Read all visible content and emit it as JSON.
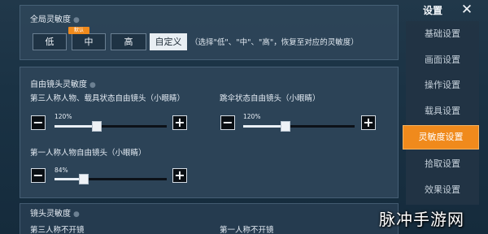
{
  "header": {
    "title": "设置",
    "close_glyph": "✕"
  },
  "global_sensitivity": {
    "title": "全局灵敏度",
    "recommended_badge": "默认",
    "options": [
      {
        "label": "低"
      },
      {
        "label": "中"
      },
      {
        "label": "高"
      },
      {
        "label": "自定义"
      }
    ],
    "selected": "自定义",
    "hint": "（选择\"低\"、\"中\"、\"高\"，恢复至对应的灵敏度）"
  },
  "free_camera": {
    "title": "自由镜头灵敏度",
    "sliders": [
      {
        "label": "第三人称人物、载具状态自由镜头（小眼睛）",
        "value_text": "120%",
        "fraction": 0.38
      },
      {
        "label": "跳伞状态自由镜头（小眼睛）",
        "value_text": "120%",
        "fraction": 0.38
      },
      {
        "label": "第一人称人物自由镜头（小眼睛）",
        "value_text": "84%",
        "fraction": 0.26
      }
    ]
  },
  "lens_sensitivity": {
    "title": "镜头灵敏度",
    "labels": [
      "第三人称不开镜",
      "第一人称不开镜"
    ]
  },
  "sidebar": {
    "items": [
      {
        "label": "基础设置"
      },
      {
        "label": "画面设置"
      },
      {
        "label": "操作设置"
      },
      {
        "label": "载具设置"
      },
      {
        "label": "灵敏度设置"
      },
      {
        "label": "拾取设置"
      },
      {
        "label": "效果设置"
      }
    ],
    "active_index": 4
  },
  "watermark": "脉冲手游网",
  "colors": {
    "accent": "#f08a1c",
    "panel": "#2d4458",
    "background": "#1a3244"
  },
  "icons": {
    "plus": "plus-icon",
    "minus": "minus-icon",
    "close": "close-icon"
  }
}
